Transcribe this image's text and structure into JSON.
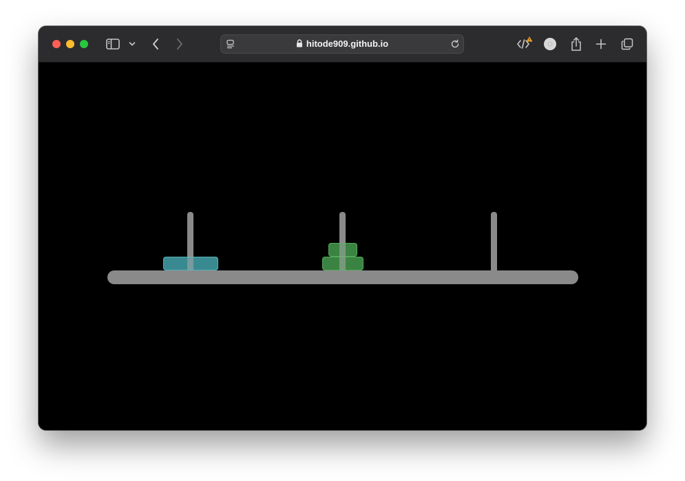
{
  "browser": {
    "url": "hitode909.github.io",
    "icons": {
      "sidebar": "sidebar-icon",
      "chevron": "chevron-down-icon",
      "back": "back-arrow-icon",
      "forward": "forward-arrow-icon",
      "page_menu": "page-menu-icon",
      "lock": "lock-icon",
      "reload": "reload-icon",
      "devtools": "code-brackets-icon",
      "warning": "warning-badge-icon",
      "extension": "extension-circle-icon",
      "share": "share-icon",
      "new_tab": "plus-icon",
      "tab_overview": "tab-overview-icon"
    },
    "colors": {
      "toolbar": "#2c2c2e",
      "address_bar": "#3a3a3c"
    }
  },
  "game": {
    "name": "Tower of Hanoi",
    "pegs": [
      {
        "id": "peg-1",
        "disks": [
          {
            "size": 3,
            "color": "#46a8b0"
          }
        ]
      },
      {
        "id": "peg-2",
        "disks": [
          {
            "size": 2,
            "color": "#48a050"
          },
          {
            "size": 1,
            "color": "#48a050"
          }
        ]
      },
      {
        "id": "peg-3",
        "disks": []
      }
    ],
    "colors": {
      "background": "#000000",
      "base": "#8a8a8a",
      "peg": "#8a8a8a"
    }
  }
}
